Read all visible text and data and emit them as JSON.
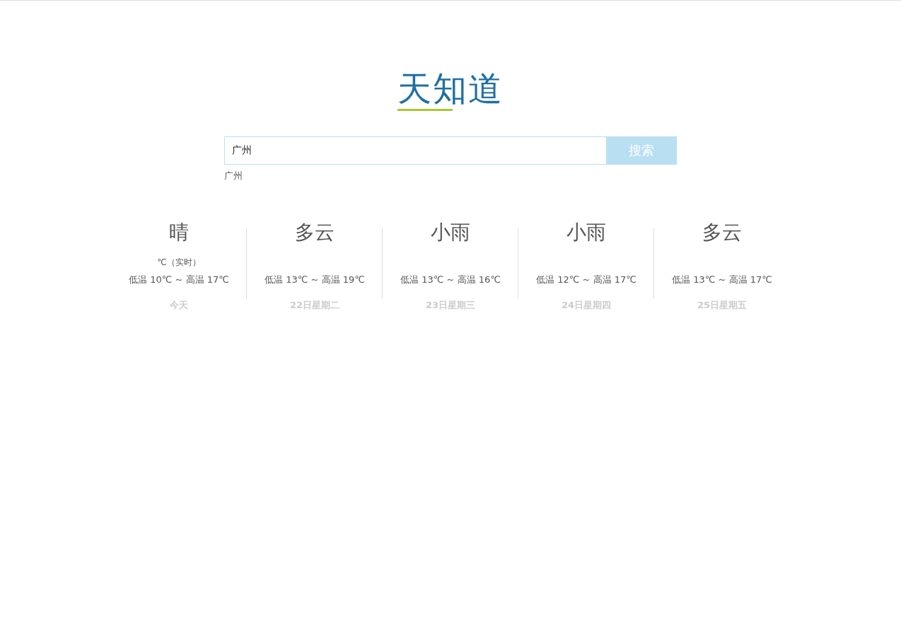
{
  "logo": {
    "text": "天知道"
  },
  "search": {
    "value": "广州",
    "button": "搜索"
  },
  "suggestions": [
    "广州"
  ],
  "forecast": [
    {
      "weather": "晴",
      "current": "℃（实时）",
      "range": "低温 10℃ ~ 高温 17℃",
      "day": "今天"
    },
    {
      "weather": "多云",
      "range": "低温 13℃ ~ 高温 19℃",
      "day": "22日星期二"
    },
    {
      "weather": "小雨",
      "range": "低温 13℃ ~ 高温 16℃",
      "day": "23日星期三"
    },
    {
      "weather": "小雨",
      "range": "低温 12℃ ~ 高温 17℃",
      "day": "24日星期四"
    },
    {
      "weather": "多云",
      "range": "低温 13℃ ~ 高温 17℃",
      "day": "25日星期五"
    }
  ]
}
